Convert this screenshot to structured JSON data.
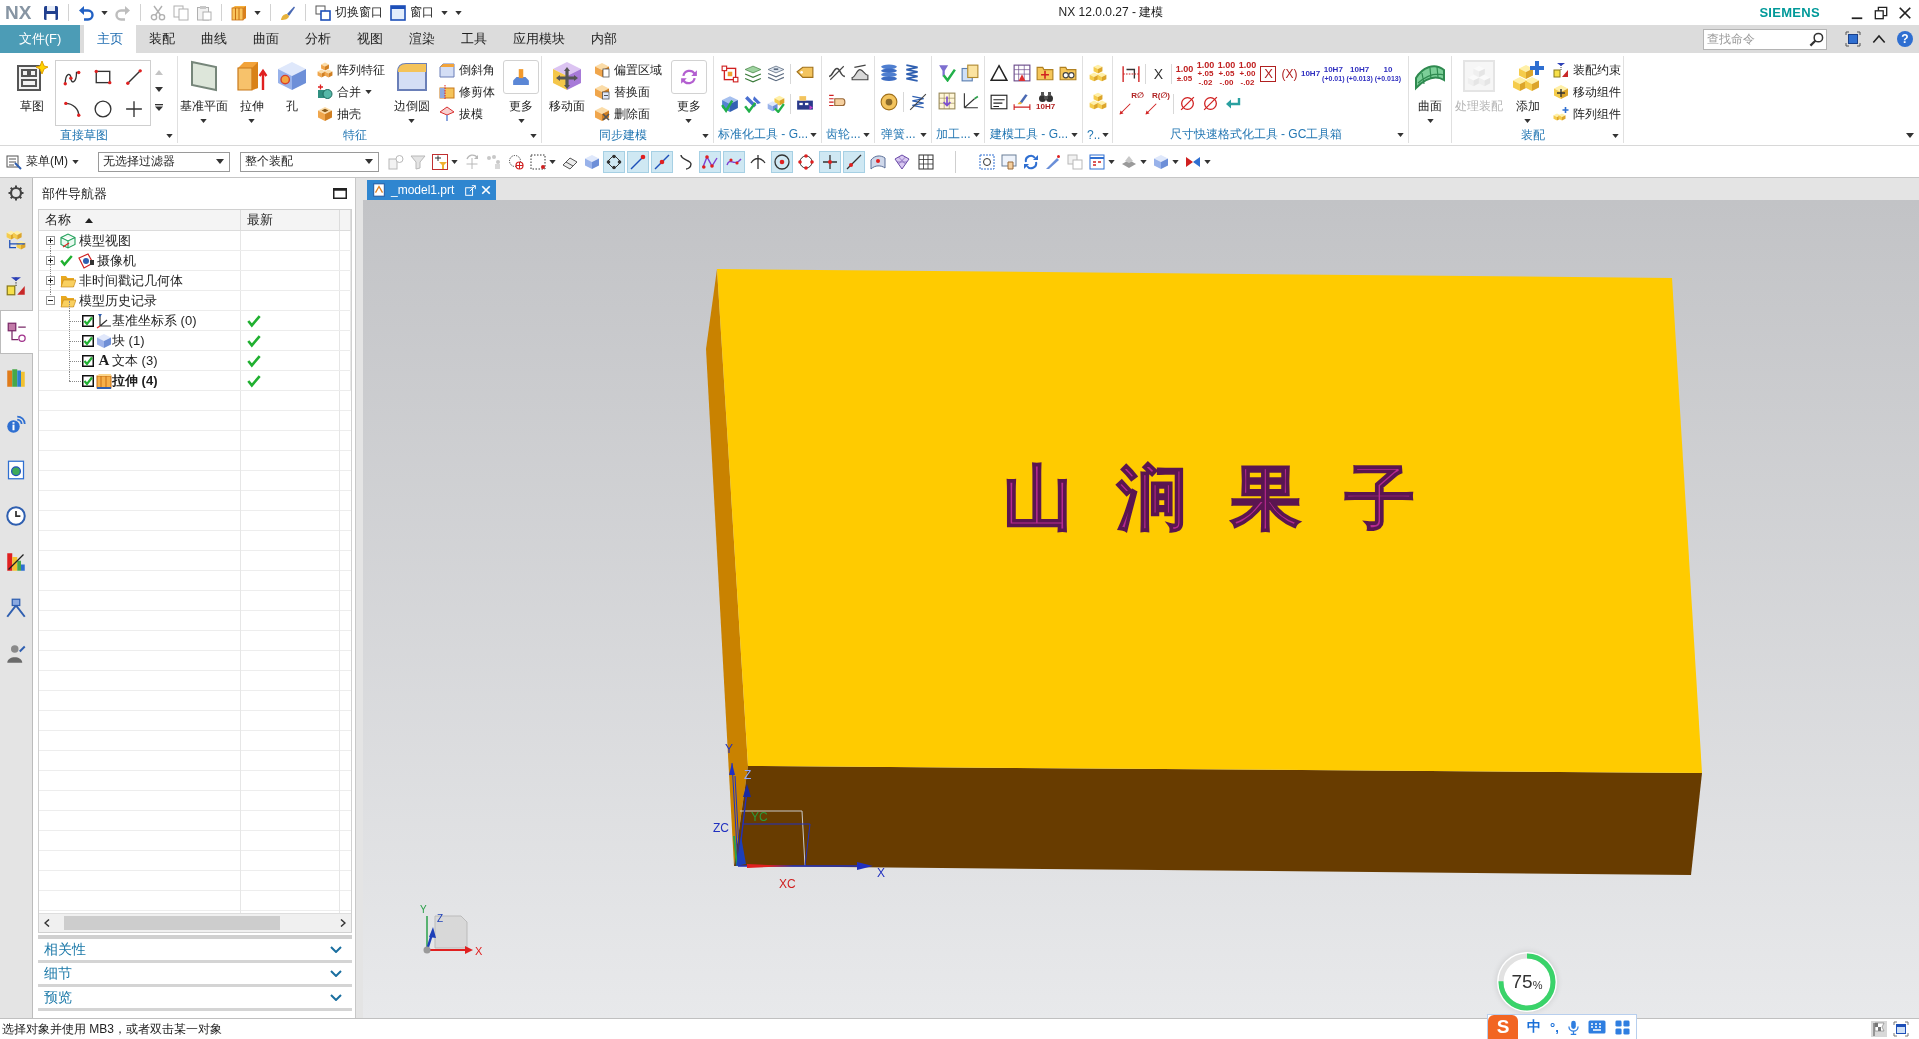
{
  "title_bar": {
    "logo": "NX",
    "quick_access": [
      {
        "label": "切换窗口"
      },
      {
        "label": "窗口"
      }
    ],
    "title": "NX 12.0.0.27 - 建模",
    "brand": "SIEMENS"
  },
  "menu_tabs": [
    {
      "kind": "file",
      "label": "文件(F)",
      "selected": false
    },
    {
      "kind": "tab",
      "label": "主页",
      "selected": true
    },
    {
      "kind": "tab",
      "label": "装配",
      "selected": false
    },
    {
      "kind": "tab",
      "label": "曲线",
      "selected": false
    },
    {
      "kind": "tab",
      "label": "曲面",
      "selected": false
    },
    {
      "kind": "tab",
      "label": "分析",
      "selected": false
    },
    {
      "kind": "tab",
      "label": "视图",
      "selected": false
    },
    {
      "kind": "tab",
      "label": "渲染",
      "selected": false
    },
    {
      "kind": "tab",
      "label": "工具",
      "selected": false
    },
    {
      "kind": "tab",
      "label": "应用模块",
      "selected": false
    },
    {
      "kind": "tab",
      "label": "内部",
      "selected": false
    }
  ],
  "search": {
    "placeholder": "查找命令"
  },
  "help": {
    "label": "?"
  },
  "ribbon": {
    "groups": [
      {
        "label": "直接草图",
        "items": [
          {
            "kind": "large",
            "label": "草图",
            "dropdown": false
          },
          {
            "kind": "gallery"
          }
        ]
      },
      {
        "label": "特征",
        "items": [
          {
            "kind": "large",
            "label": "基准平面",
            "dropdown": true
          },
          {
            "kind": "large",
            "label": "拉伸",
            "dropdown": true
          },
          {
            "kind": "large",
            "label": "孔",
            "dropdown": false
          },
          {
            "kind": "stack",
            "buttons": [
              {
                "label": "阵列特征",
                "dropdown": false
              },
              {
                "label": "合并",
                "dropdown": true
              },
              {
                "label": "抽壳",
                "dropdown": false
              }
            ]
          },
          {
            "kind": "large",
            "label": "边倒圆",
            "dropdown": true
          },
          {
            "kind": "stack",
            "buttons": [
              {
                "label": "倒斜角",
                "dropdown": false
              },
              {
                "label": "修剪体",
                "dropdown": false
              },
              {
                "label": "拔模",
                "dropdown": false
              }
            ]
          },
          {
            "kind": "more",
            "label": "更多",
            "dropdown": true
          }
        ]
      },
      {
        "label": "同步建模",
        "items": [
          {
            "kind": "large",
            "label": "移动面",
            "dropdown": false
          },
          {
            "kind": "stack",
            "buttons": [
              {
                "label": "偏置区域",
                "dropdown": false
              },
              {
                "label": "替换面",
                "dropdown": false
              },
              {
                "label": "删除面",
                "dropdown": false
              }
            ]
          },
          {
            "kind": "more",
            "label": "更多",
            "dropdown": true
          }
        ]
      },
      {
        "label": "标准化工具 - G...",
        "items": [
          {
            "kind": "icons"
          }
        ]
      },
      {
        "label": "齿轮...",
        "items": [
          {
            "kind": "icons"
          }
        ]
      },
      {
        "label": "弹簧...",
        "items": [
          {
            "kind": "icons"
          }
        ]
      },
      {
        "label": "加工...",
        "items": [
          {
            "kind": "icons"
          }
        ]
      },
      {
        "label": "建模工具 - G...",
        "items": [
          {
            "kind": "icons",
            "captions": [
              "10H7"
            ]
          }
        ]
      },
      {
        "label": "?..",
        "items": [
          {
            "kind": "icons"
          }
        ]
      },
      {
        "label": "尺寸快速格式化工具 - GC工具箱",
        "items": [
          {
            "kind": "dim_tools",
            "top": [
              {
                "kind": "plain",
                "text": "X"
              },
              {
                "kind": "tolerance",
                "value": "1.00",
                "limits": [
                  "±.05"
                ]
              },
              {
                "kind": "tolerance",
                "value": "1.00",
                "limits": [
                  "+.05",
                  "-.02"
                ]
              },
              {
                "kind": "tolerance",
                "value": "1.00",
                "limits": [
                  "+.05",
                  "-.00"
                ]
              },
              {
                "kind": "tolerance",
                "value": "1.00",
                "limits": [
                  "+.00",
                  "-.02"
                ]
              },
              {
                "kind": "boxed",
                "text": "X"
              },
              {
                "kind": "paren",
                "text": "(X)"
              },
              {
                "kind": "fit",
                "value": "10H7"
              },
              {
                "kind": "fit",
                "value": "10H7",
                "limits": [
                  "(+0.01)"
                ]
              },
              {
                "kind": "fit",
                "value": "10H7",
                "limits": [
                  "(+0.013)"
                ]
              },
              {
                "kind": "fit",
                "value": "10",
                "limits": [
                  "(+0.013)"
                ]
              }
            ],
            "bottom": [
              {
                "kind": "radius",
                "text": "R∅"
              },
              {
                "kind": "radius",
                "text": "R(∅)"
              }
            ]
          }
        ]
      },
      {
        "items": [
          {
            "kind": "large",
            "label": "曲面",
            "dropdown": true
          }
        ]
      },
      {
        "label": "装配",
        "items": [
          {
            "kind": "large",
            "label": "处理装配",
            "dropdown": false,
            "disabled": true
          },
          {
            "kind": "large",
            "label": "添加",
            "dropdown": true,
            "disabled": false
          },
          {
            "kind": "stack",
            "buttons": [
              {
                "label": "装配约束",
                "dropdown": false,
                "disabled": false
              },
              {
                "label": "移动组件",
                "dropdown": false,
                "disabled": false
              },
              {
                "label": "阵列组件",
                "dropdown": false,
                "disabled": false
              }
            ]
          }
        ]
      }
    ]
  },
  "selection_bar": {
    "menu": "菜单(M)",
    "filters": [
      {
        "value": "无选择过滤器"
      },
      {
        "value": "整个装配"
      }
    ],
    "snap_points": [
      {
        "on": true
      },
      {
        "on": true
      },
      {
        "on": true
      },
      {
        "on": false
      },
      {
        "on": true
      },
      {
        "on": true
      },
      {
        "on": false
      },
      {
        "on": true
      },
      {
        "on": false
      },
      {
        "on": true
      },
      {
        "on": true
      },
      {
        "on": false
      },
      {
        "on": false
      },
      {
        "on": false
      }
    ]
  },
  "resource_bar": [
    {
      "selected": false
    },
    {
      "selected": false
    },
    {
      "selected": true
    },
    {
      "selected": false
    },
    {
      "selected": false
    },
    {
      "selected": false
    },
    {
      "selected": false
    },
    {
      "selected": false
    },
    {
      "selected": false
    },
    {
      "selected": false
    }
  ],
  "part_navigator": {
    "title": "部件导航器",
    "columns": [
      {
        "label": "名称",
        "sorted": true
      },
      {
        "label": "最新",
        "sorted": false
      }
    ],
    "tree": [
      {
        "kind": "view",
        "label": "模型视图",
        "expanded": false,
        "checked": false
      },
      {
        "kind": "camera",
        "label": "摄像机",
        "expanded": false,
        "checked": true
      },
      {
        "kind": "folder",
        "label": "非时间戳记几何体",
        "expanded": false,
        "checked": false
      },
      {
        "kind": "folder",
        "label": "模型历史记录",
        "expanded": true,
        "checked": false,
        "children": [
          {
            "kind": "datum",
            "label": "基准坐标系 (0)",
            "checked": true,
            "latest": true,
            "current": false
          },
          {
            "kind": "block",
            "label": "块 (1)",
            "checked": true,
            "latest": true,
            "current": false
          },
          {
            "kind": "text",
            "glyph": "A",
            "label": "文本 (3)",
            "checked": true,
            "latest": true,
            "current": false
          },
          {
            "kind": "extrude",
            "label": "拉伸 (4)",
            "checked": true,
            "latest": true,
            "current": true
          }
        ]
      }
    ],
    "panels": [
      {
        "label": "相关性",
        "expanded": false
      },
      {
        "label": "细节",
        "expanded": false
      },
      {
        "label": "预览",
        "expanded": false
      }
    ]
  },
  "viewport": {
    "tab": {
      "label": "_model1.prt"
    },
    "model_text": "山涧果子",
    "datum_labels": [
      "Y",
      "Z",
      "YC",
      "ZC",
      "XC",
      "X"
    ],
    "triad_labels": [
      "Y",
      "Z",
      "X"
    ]
  },
  "status_bar": {
    "text": "选择对象并使用 MB3，或者双击某一对象"
  },
  "speed_widget": {
    "value": "75",
    "unit": "%",
    "level": 0.75
  },
  "ime_bar": {
    "logo": "S",
    "mode": "中",
    "punctuation": "°,"
  }
}
